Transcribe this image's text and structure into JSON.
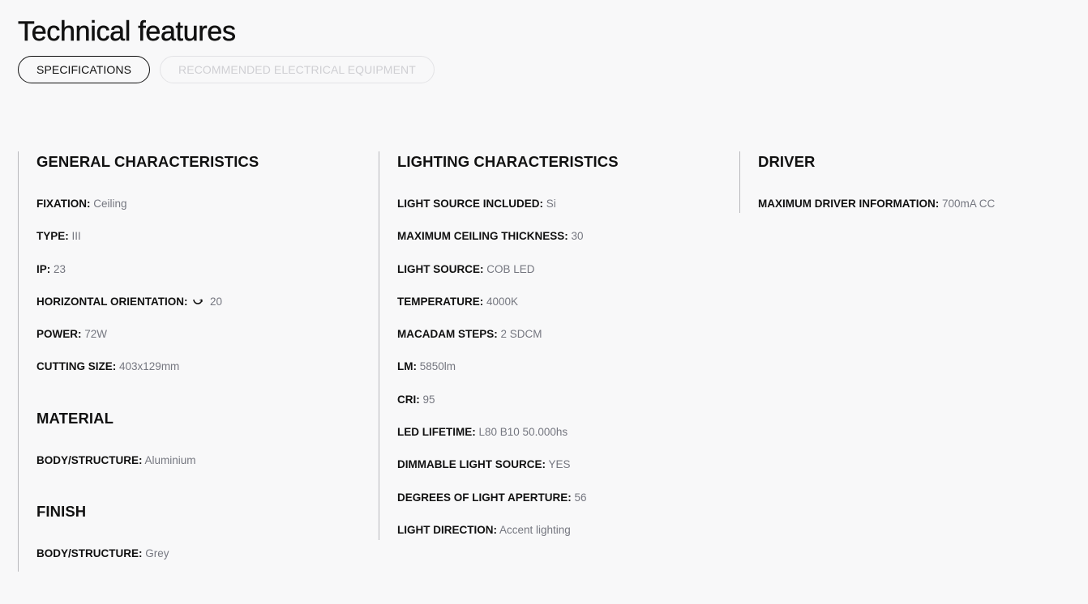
{
  "page": {
    "title": "Technical features"
  },
  "tabs": [
    {
      "label": "SPECIFICATIONS",
      "active": true
    },
    {
      "label": "RECOMMENDED ELECTRICAL EQUIPMENT",
      "active": false
    }
  ],
  "columns": {
    "general": {
      "title": "GENERAL CHARACTERISTICS",
      "rows": [
        {
          "label": "FIXATION:",
          "value": "Ceiling"
        },
        {
          "label": "TYPE:",
          "value": "III"
        },
        {
          "label": "IP:",
          "value": "23"
        },
        {
          "label": "HORIZONTAL ORIENTATION:",
          "icon": "rotate-icon",
          "value": "20"
        },
        {
          "label": "POWER:",
          "value": "72W"
        },
        {
          "label": "CUTTING SIZE:",
          "value": "403x129mm"
        }
      ]
    },
    "material": {
      "title": "MATERIAL",
      "rows": [
        {
          "label": "BODY/STRUCTURE:",
          "value": "Aluminium"
        }
      ]
    },
    "finish": {
      "title": "FINISH",
      "rows": [
        {
          "label": "BODY/STRUCTURE:",
          "value": "Grey"
        }
      ]
    },
    "lighting": {
      "title": "LIGHTING CHARACTERISTICS",
      "rows": [
        {
          "label": "LIGHT SOURCE INCLUDED:",
          "value": "Si"
        },
        {
          "label": "MAXIMUM CEILING THICKNESS:",
          "value": "30"
        },
        {
          "label": "LIGHT SOURCE:",
          "value": "COB LED"
        },
        {
          "label": "TEMPERATURE:",
          "value": "4000K"
        },
        {
          "label": "MACADAM STEPS:",
          "value": "2 SDCM"
        },
        {
          "label": "LM:",
          "value": "5850lm"
        },
        {
          "label": "CRI:",
          "value": "95"
        },
        {
          "label": "LED LIFETIME:",
          "value": "L80 B10 50.000hs"
        },
        {
          "label": "DIMMABLE LIGHT SOURCE:",
          "value": "YES"
        },
        {
          "label": "DEGREES OF LIGHT APERTURE:",
          "value": "56"
        },
        {
          "label": "LIGHT DIRECTION:",
          "value": "Accent lighting"
        }
      ]
    },
    "driver": {
      "title": "DRIVER",
      "rows": [
        {
          "label": "MAXIMUM DRIVER INFORMATION:",
          "value": "700mA CC"
        }
      ]
    }
  },
  "colors": {
    "background": "#f8f8f9",
    "text": "#111111",
    "value_text": "#757780",
    "divider": "#b9b9bd",
    "inactive_tab": "#cfcfd3"
  }
}
